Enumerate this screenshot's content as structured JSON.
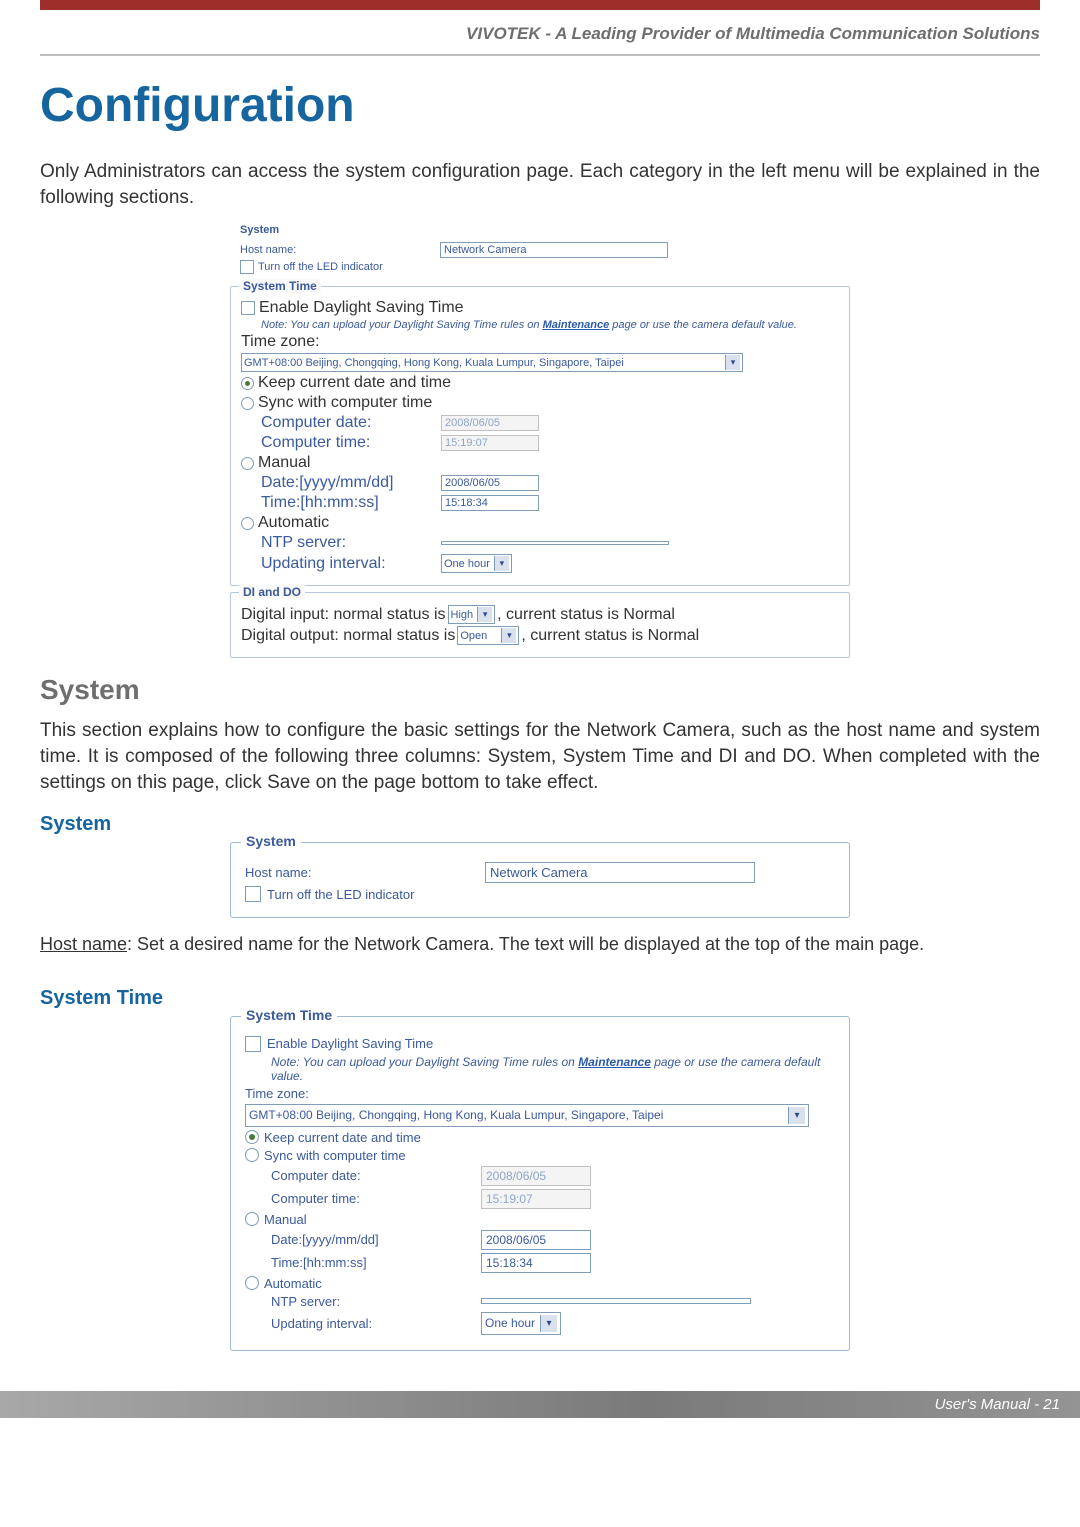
{
  "header": {
    "banner": "VIVOTEK - A Leading Provider of Multimedia Communication Solutions"
  },
  "title": "Configuration",
  "intro": "Only Administrators can access the system configuration page. Each category in the left menu will be explained in the following sections.",
  "screenshot1": {
    "system_legend": "System",
    "host_label": "Host name:",
    "host_value": "Network Camera",
    "led_label": "Turn off the LED indicator",
    "time_legend": "System Time",
    "dst_label": "Enable Daylight Saving Time",
    "dst_note_pre": "Note: You can upload your Daylight Saving Time rules on ",
    "dst_note_link": "Maintenance",
    "dst_note_post": " page or use the camera default value.",
    "tz_label": "Time zone:",
    "tz_value": "GMT+08:00 Beijing, Chongqing, Hong Kong, Kuala Lumpur, Singapore, Taipei",
    "r_keep": "Keep current date and time",
    "r_sync": "Sync with computer time",
    "cdate_label": "Computer date:",
    "cdate_value": "2008/06/05",
    "ctime_label": "Computer time:",
    "ctime_value": "15:19:07",
    "r_manual": "Manual",
    "mdate_label": "Date:[yyyy/mm/dd]",
    "mdate_value": "2008/06/05",
    "mtime_label": "Time:[hh:mm:ss]",
    "mtime_value": "15:18:34",
    "r_auto": "Automatic",
    "ntp_label": "NTP server:",
    "ntp_value": "",
    "upd_label": "Updating interval:",
    "upd_value": "One hour",
    "dido_legend": "DI and DO",
    "di_pre": "Digital input: normal status is ",
    "di_sel": "High",
    "di_post": " , current status is Normal",
    "do_pre": "Digital output: normal status is ",
    "do_sel": "Open",
    "do_post": " , current status is Normal"
  },
  "system_head": "System",
  "system_para": "This section explains how to configure the basic settings for the Network Camera, such as the host name and system time. It is composed of the following three columns: System, System Time and DI and DO. When completed with the settings on this page, click Save on the page bottom to take effect.",
  "sub_system": "System",
  "screenshot2": {
    "legend": "System",
    "host_label": "Host name:",
    "host_value": "Network Camera",
    "led_label": "Turn off the LED indicator"
  },
  "hostname_para_lead": "Host name",
  "hostname_para_rest": ": Set a desired name for the Network Camera. The text will be displayed at the top of the main page.",
  "sub_time": "System Time",
  "screenshot3": {
    "legend": "System Time",
    "dst_label": "Enable Daylight Saving Time",
    "dst_note_pre": "Note: You can upload your Daylight Saving Time rules on ",
    "dst_note_link": "Maintenance",
    "dst_note_post": " page or use the camera default value.",
    "tz_label": "Time zone:",
    "tz_value": "GMT+08:00 Beijing, Chongqing, Hong Kong, Kuala Lumpur, Singapore, Taipei",
    "r_keep": "Keep current date and time",
    "r_sync": "Sync with computer time",
    "cdate_label": "Computer date:",
    "cdate_value": "2008/06/05",
    "ctime_label": "Computer time:",
    "ctime_value": "15:19:07",
    "r_manual": "Manual",
    "mdate_label": "Date:[yyyy/mm/dd]",
    "mdate_value": "2008/06/05",
    "mtime_label": "Time:[hh:mm:ss]",
    "mtime_value": "15:18:34",
    "r_auto": "Automatic",
    "ntp_label": "NTP server:",
    "ntp_value": "",
    "upd_label": "Updating interval:",
    "upd_value": "One hour"
  },
  "footer": "User's Manual - 21"
}
